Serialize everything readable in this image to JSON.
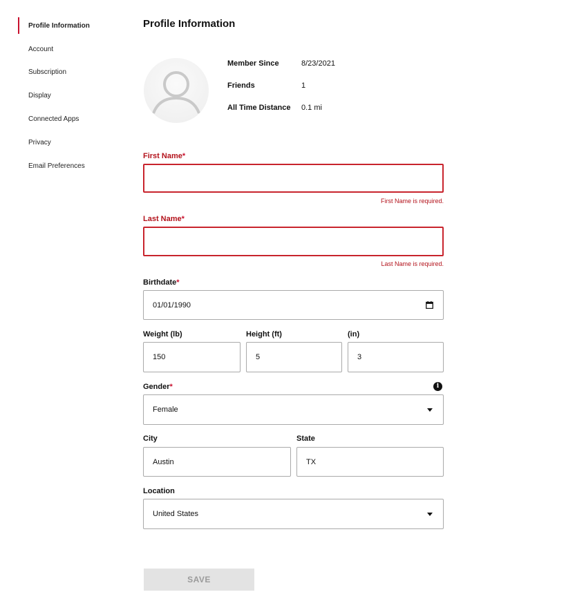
{
  "sidebar": {
    "items": [
      {
        "label": "Profile Information",
        "active": true
      },
      {
        "label": "Account"
      },
      {
        "label": "Subscription"
      },
      {
        "label": "Display"
      },
      {
        "label": "Connected Apps"
      },
      {
        "label": "Privacy"
      },
      {
        "label": "Email Preferences"
      }
    ]
  },
  "header": {
    "title": "Profile Information"
  },
  "profile": {
    "stats": [
      {
        "label": "Member Since",
        "value": "8/23/2021"
      },
      {
        "label": "Friends",
        "value": "1"
      },
      {
        "label": "All Time Distance",
        "value": "0.1 mi"
      }
    ]
  },
  "form": {
    "first_name": {
      "label": "First Name",
      "required_mark": "*",
      "value": "",
      "error": "First Name is required."
    },
    "last_name": {
      "label": "Last Name",
      "required_mark": "*",
      "value": "",
      "error": "Last Name is required."
    },
    "birthdate": {
      "label": "Birthdate",
      "required_mark": "*",
      "value": "01/01/1990"
    },
    "weight": {
      "label": "Weight (lb)",
      "value": "150"
    },
    "height_ft": {
      "label": "Height (ft)",
      "value": "5"
    },
    "height_in": {
      "label": "(in)",
      "value": "3"
    },
    "gender": {
      "label": "Gender",
      "required_mark": "*",
      "value": "Female",
      "info_icon": "i"
    },
    "city": {
      "label": "City",
      "value": "Austin"
    },
    "state": {
      "label": "State",
      "value": "TX"
    },
    "location": {
      "label": "Location",
      "value": "United States"
    },
    "save_label": "SAVE"
  },
  "colors": {
    "accent": "#c8102e",
    "error": "#b3121b",
    "disabled_bg": "#e3e3e3"
  }
}
